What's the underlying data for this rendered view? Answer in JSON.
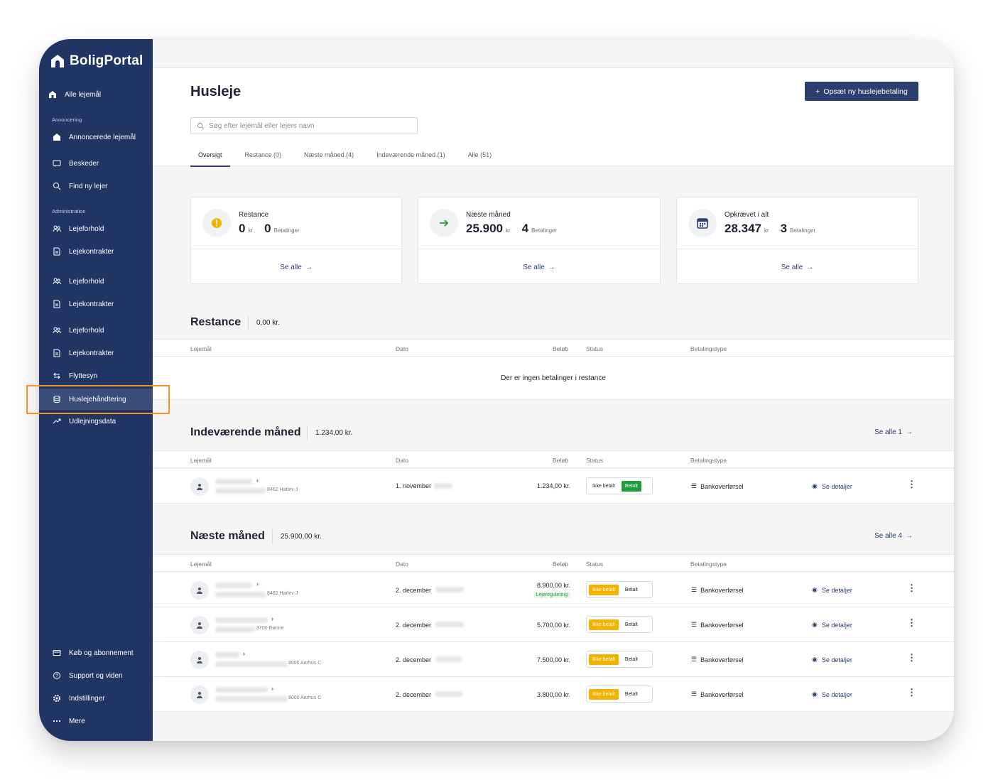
{
  "app": {
    "name": "BoligPortal",
    "page_title": "Husleje",
    "cta_label": "Opsæt ny huslejebetaling"
  },
  "sidebar": {
    "top_item": "Alle lejemål",
    "section_annoncering": "Annoncering",
    "section_administration": "Administration",
    "items": [
      "Annoncerede lejemål",
      "Beskeder",
      "Find ny lejer",
      "Lejeforhold",
      "Lejekontrakter",
      "Lejeforhold",
      "Lejekontrakter",
      "Lejeforhold",
      "Lejekontrakter",
      "Flyttesyn",
      "Huslejehåndtering",
      "Udlejningsdata"
    ],
    "bottom_items": [
      "Køb og abonnement",
      "Support og viden",
      "Indstillinger",
      "Mere"
    ],
    "active_item": "Huslejehåndtering"
  },
  "search": {
    "placeholder": "Søg efter lejemål eller lejers navn"
  },
  "tabs": [
    "Oversigt",
    "Restance (0)",
    "Næste måned (4)",
    "Indeværende måned (1)",
    "Alle (51)"
  ],
  "cards": [
    {
      "label": "Restance",
      "amount": "0",
      "unit": "kr",
      "count": "0",
      "count_label": "Betalinger",
      "see_all": "Se alle",
      "icon": "warning-icon"
    },
    {
      "label": "Næste måned",
      "amount": "25.900",
      "unit": "kr",
      "count": "4",
      "count_label": "Betalinger",
      "see_all": "Se alle",
      "icon": "arrow-right-icon"
    },
    {
      "label": "Opkrævet i alt",
      "amount": "28.347",
      "unit": "kr",
      "count": "3",
      "count_label": "Betalinger",
      "see_all": "Se alle",
      "icon": "calendar-icon"
    }
  ],
  "columns": {
    "lejemaal": "Lejemål",
    "dato": "Dato",
    "beloeb": "Beløb",
    "status": "Status",
    "betalingstype": "Betalingstype"
  },
  "restance": {
    "title": "Restance",
    "sum": "0,00 kr.",
    "empty": "Der er ingen betalinger i restance"
  },
  "current": {
    "title": "Indeværende måned",
    "sum": "1.234,00 kr.",
    "see_all": "Se alle 1",
    "rows": [
      {
        "address": "8462 Harlev J",
        "date": "1. november",
        "amount": "1.234,00 kr.",
        "unpaid": "Ikke betalt",
        "paid": "Betalt",
        "state": "paid",
        "type": "Bankoverførsel",
        "details": "Se detaljer"
      }
    ]
  },
  "next": {
    "title": "Næste måned",
    "sum": "25.900,00 kr.",
    "see_all": "Se alle 4",
    "rows": [
      {
        "address": "8462 Harlev J",
        "date": "2. december",
        "amount": "8.900,00 kr.",
        "tag": "Lejeregulering",
        "unpaid": "Ikke betalt",
        "paid": "Betalt",
        "state": "unpaid",
        "type": "Bankoverførsel",
        "details": "Se detaljer"
      },
      {
        "address": "3700 Rønne",
        "date": "2. december",
        "amount": "5.700,00 kr.",
        "unpaid": "Ikke betalt",
        "paid": "Betalt",
        "state": "unpaid",
        "type": "Bankoverførsel",
        "details": "Se detaljer"
      },
      {
        "address": "8000 Aarhus C",
        "date": "2. december",
        "amount": "7.500,00 kr.",
        "unpaid": "Ikke betalt",
        "paid": "Betalt",
        "state": "unpaid",
        "type": "Bankoverførsel",
        "details": "Se detaljer"
      },
      {
        "address": "8000 Aarhus C",
        "date": "2. december",
        "amount": "3.800,00 kr.",
        "unpaid": "Ikke betalt",
        "paid": "Betalt",
        "state": "unpaid",
        "type": "Bankoverførsel",
        "details": "Se detaljer"
      }
    ]
  },
  "colors": {
    "sidebar": "#213564",
    "primary": "#2c3e6e",
    "paid": "#1f9d3a",
    "unpaid": "#f5b300",
    "highlight": "#f39424"
  }
}
